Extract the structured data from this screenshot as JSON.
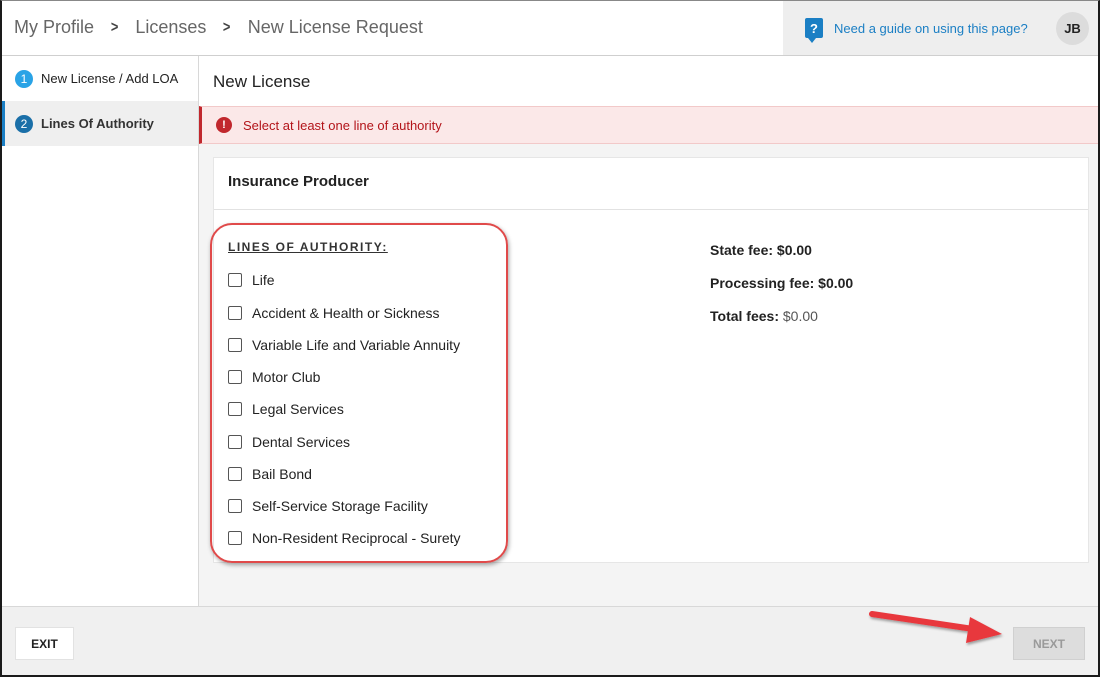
{
  "breadcrumb": {
    "items": [
      "My Profile",
      "Licenses",
      "New License Request"
    ],
    "separator": ">"
  },
  "help": {
    "icon": "question-icon",
    "icon_glyph": "?",
    "label": "Need a guide on using this page?"
  },
  "user": {
    "initials": "JB"
  },
  "sidebar": {
    "steps": [
      {
        "number": "1",
        "label": "New License / Add LOA",
        "active": false
      },
      {
        "number": "2",
        "label": "Lines Of Authority",
        "active": true
      }
    ]
  },
  "main": {
    "title": "New License",
    "error": {
      "icon_glyph": "!",
      "message": "Select at least one line of authority"
    },
    "card": {
      "title": "Insurance Producer",
      "loa_heading": "LINES OF AUTHORITY:",
      "lines_of_authority": [
        {
          "label": "Life",
          "checked": false
        },
        {
          "label": "Accident & Health or Sickness",
          "checked": false
        },
        {
          "label": "Variable Life and Variable Annuity",
          "checked": false
        },
        {
          "label": "Motor Club",
          "checked": false
        },
        {
          "label": "Legal Services",
          "checked": false
        },
        {
          "label": "Dental Services",
          "checked": false
        },
        {
          "label": "Bail Bond",
          "checked": false
        },
        {
          "label": "Self-Service Storage Facility",
          "checked": false
        },
        {
          "label": "Non-Resident Reciprocal - Surety",
          "checked": false
        }
      ],
      "fees": {
        "state_label": "State fee:",
        "state_value": "$0.00",
        "processing_label": "Processing fee:",
        "processing_value": "$0.00",
        "total_label": "Total fees:",
        "total_value": "$0.00"
      }
    }
  },
  "footer": {
    "exit_label": "EXIT",
    "next_label": "NEXT",
    "next_disabled": true
  },
  "colors": {
    "accent": "#1b7fc4",
    "error": "#c1272d",
    "error_bg": "#fbe8e8",
    "annotation": "#e04a4a"
  }
}
